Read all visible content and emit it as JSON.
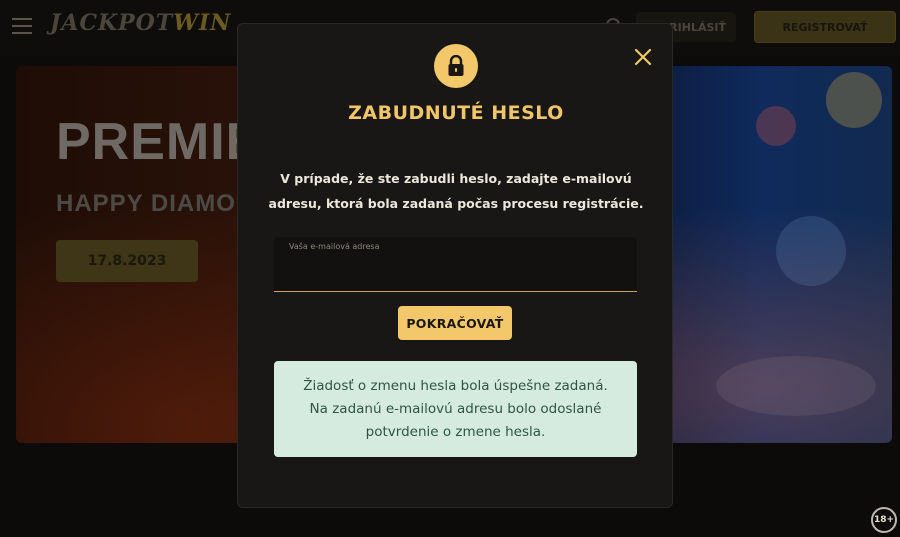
{
  "background": {
    "logo": {
      "text_a": "JACKPOT",
      "text_b": "WIN"
    },
    "header": {
      "login_label": "PRIHLÁSIŤ",
      "register_label": "REGISTROVAŤ"
    },
    "banner": {
      "headline": "PREMIÉ",
      "subheadline": "HAPPY DIAMO",
      "date_button": "17.8.2023"
    },
    "age_badge": "18+"
  },
  "modal": {
    "title": "ZABUDNUTÉ HESLO",
    "description_line1": "V prípade, že ste zabudli heslo, zadajte e-mailovú",
    "description_line2": "adresu, ktorá bola zadaná počas procesu registrácie.",
    "email_field": {
      "label": "Vaša e-mailová adresa",
      "value": ""
    },
    "continue_label": "POKRAČOVAŤ",
    "success_line1": "Žiadosť o zmenu hesla bola úspešne zadaná.",
    "success_line2": "Na zadanú e-mailovú adresu bolo odoslané",
    "success_line3": "potvrdenie o zmene hesla."
  },
  "icons": {
    "lock": "lock-icon",
    "close": "close-icon",
    "menu": "hamburger-icon",
    "search": "search-icon"
  },
  "colors": {
    "accent": "#f3c86a",
    "modal_bg": "#181715",
    "success_bg": "#d6ebe0",
    "success_text": "#2f5546"
  }
}
